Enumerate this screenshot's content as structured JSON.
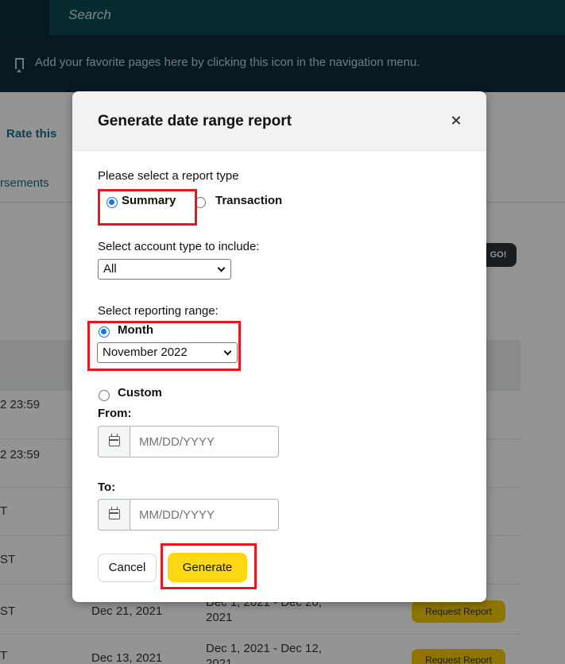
{
  "search": {
    "placeholder": "Search"
  },
  "favorites": {
    "text": "Add your favorite pages here by clicking this icon in the navigation menu."
  },
  "background": {
    "rate_link": "Rate this",
    "tab_partial": "rsements",
    "go_label": "GO!",
    "rows": [
      {
        "col1": "2 23:59",
        "col2": "",
        "col3": "",
        "col3b": "",
        "action": ""
      },
      {
        "col1": "2 23:59",
        "col2": "",
        "col3": "",
        "col3b": "",
        "action": ""
      },
      {
        "col1": "T",
        "col2": "",
        "col3": "",
        "col3b": "",
        "action": ""
      },
      {
        "col1": "ST",
        "col2": "",
        "col3": "",
        "col3b": "",
        "action": ""
      },
      {
        "col1": "ST",
        "col2": "",
        "col3": "",
        "col3b": "",
        "action": ""
      },
      {
        "col1": "ST",
        "col2": "Dec 21, 2021",
        "col3": "Dec 1, 2021 - Dec 20,",
        "col3b": "2021",
        "action": "Request Report"
      },
      {
        "col1": "T",
        "col2": "Dec 13, 2021",
        "col3": "Dec 1, 2021 - Dec 12,",
        "col3b": "2021",
        "action": "Request Report"
      }
    ]
  },
  "modal": {
    "title": "Generate date range report",
    "report_type_label": "Please select a report type",
    "option_summary": "Summary",
    "option_transaction": "Transaction",
    "account_type_label": "Select account type to include:",
    "account_type_value": "All",
    "reporting_range_label": "Select reporting range:",
    "option_month": "Month",
    "month_value": "November 2022",
    "option_custom": "Custom",
    "from_label": "From:",
    "from_placeholder": "MM/DD/YYYY",
    "to_label": "To:",
    "to_placeholder": "MM/DD/YYYY",
    "cancel_label": "Cancel",
    "generate_label": "Generate"
  },
  "colors": {
    "highlight": "#e3191f",
    "primary_button": "#ffd814",
    "radio_selected": "#1a73e8",
    "topbar": "#0b3a44"
  },
  "icons": [
    "bookmark-icon",
    "close-icon",
    "calendar-icon",
    "chevron-down-icon"
  ]
}
